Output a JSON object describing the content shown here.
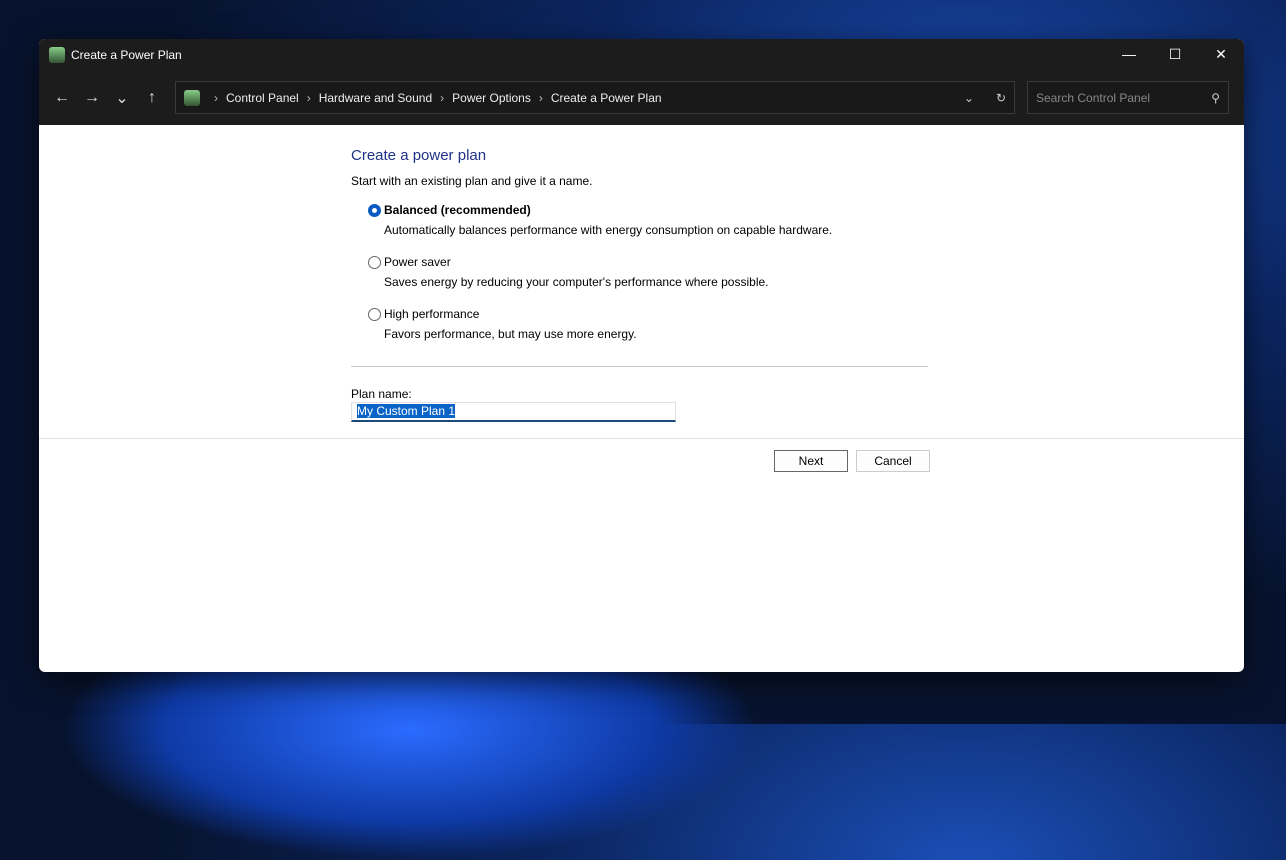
{
  "window": {
    "title": "Create a Power Plan",
    "minimize": "—",
    "maximize": "☐",
    "close": "✕"
  },
  "nav": {
    "back": "←",
    "forward": "→",
    "recent": "⌄",
    "up": "↑",
    "dropdown": "⌄",
    "refresh": "↻",
    "breadcrumb": [
      "Control Panel",
      "Hardware and Sound",
      "Power Options",
      "Create a Power Plan"
    ],
    "search_placeholder": "Search Control Panel"
  },
  "main": {
    "heading": "Create a power plan",
    "intro": "Start with an existing plan and give it a name.",
    "options": [
      {
        "label": "Balanced (recommended)",
        "desc": "Automatically balances performance with energy consumption on capable hardware.",
        "selected": true
      },
      {
        "label": "Power saver",
        "desc": "Saves energy by reducing your computer's performance where possible.",
        "selected": false
      },
      {
        "label": "High performance",
        "desc": "Favors performance, but may use more energy.",
        "selected": false
      }
    ],
    "plan_name_label": "Plan name:",
    "plan_name_value": "My Custom Plan 1",
    "next": "Next",
    "cancel": "Cancel"
  }
}
